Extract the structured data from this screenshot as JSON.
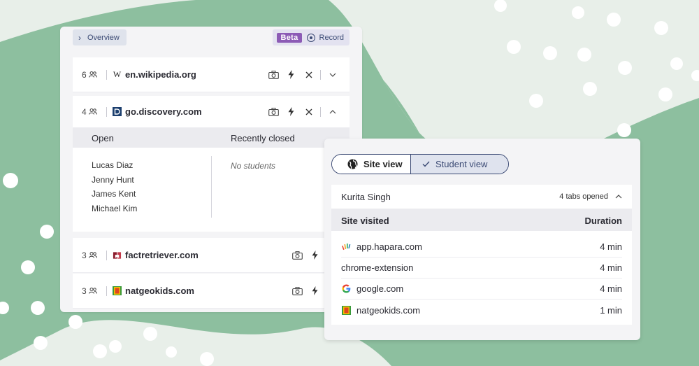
{
  "topbar": {
    "overview_label": "Overview",
    "beta_label": "Beta",
    "record_label": "Record"
  },
  "sites": [
    {
      "count": "6",
      "name": "en.wikipedia.org",
      "favicon": "wikipedia-w-icon",
      "expanded": false
    },
    {
      "count": "4",
      "name": "go.discovery.com",
      "favicon": "discovery-d-icon",
      "expanded": true
    },
    {
      "count": "3",
      "name": "factretriever.com",
      "favicon": "factretriever-icon",
      "expanded": false
    },
    {
      "count": "3",
      "name": "natgeokids.com",
      "favicon": "natgeo-icon",
      "expanded": false
    }
  ],
  "expanded": {
    "open_header": "Open",
    "closed_header": "Recently closed",
    "open_students": [
      "Lucas Diaz",
      "Jenny Hunt",
      "James Kent",
      "Michael Kim"
    ],
    "closed_empty": "No students"
  },
  "view_toggle": {
    "site_label": "Site view",
    "student_label": "Student view",
    "selected": "student"
  },
  "student_card": {
    "name": "Kurita Singh",
    "tabs_opened": "4 tabs opened",
    "col_site": "Site visited",
    "col_duration": "Duration",
    "visits": [
      {
        "site": "app.hapara.com",
        "duration": "4 min",
        "favicon": "hapara-icon"
      },
      {
        "site": "chrome-extension",
        "duration": "4 min",
        "favicon": ""
      },
      {
        "site": "google.com",
        "duration": "4 min",
        "favicon": "google-g-icon"
      },
      {
        "site": "natgeokids.com",
        "duration": "1 min",
        "favicon": "natgeo-icon"
      }
    ]
  },
  "colors": {
    "accent": "#3b4a74",
    "beta": "#8c5bb5",
    "background_green": "#8dbf9f",
    "background_light": "#e8efe9"
  }
}
